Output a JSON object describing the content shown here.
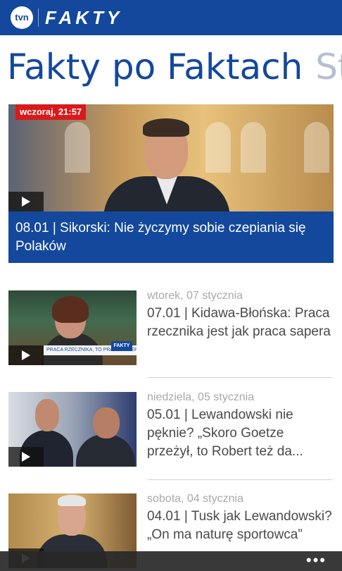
{
  "header": {
    "tvn_logo": "tvn",
    "brand": "FAKTY"
  },
  "pivot": {
    "active": "Fakty po Faktach",
    "next": "St"
  },
  "featured": {
    "badge": "wczoraj, 21:57",
    "title": "08.01 | Sikorski: Nie życzymy sobie czepiania się Polaków"
  },
  "items": [
    {
      "date": "wtorek, 07 stycznia",
      "title": "07.01 | Kidawa-Błońska: Praca rzecznika jest jak praca sapera",
      "ticker": "PRACA RZECZNIKA, TO PRACA SAPERA",
      "ticker_logo": "FAKTY"
    },
    {
      "date": "niedziela, 05 stycznia",
      "title": "05.01 | Lewandowski nie pęknie? „Skoro Goetze przeżył, to Robert też da..."
    },
    {
      "date": "sobota, 04 stycznia",
      "title": "04.01 | Tusk jak Lewandowski? „On ma naturę sportowca”"
    }
  ],
  "appbar": {
    "more": "•••"
  },
  "colors": {
    "brand_blue": "#13489c",
    "badge_red": "#d9191c",
    "date_gray": "#a9a9a9",
    "title_gray": "#4a4a4a"
  }
}
